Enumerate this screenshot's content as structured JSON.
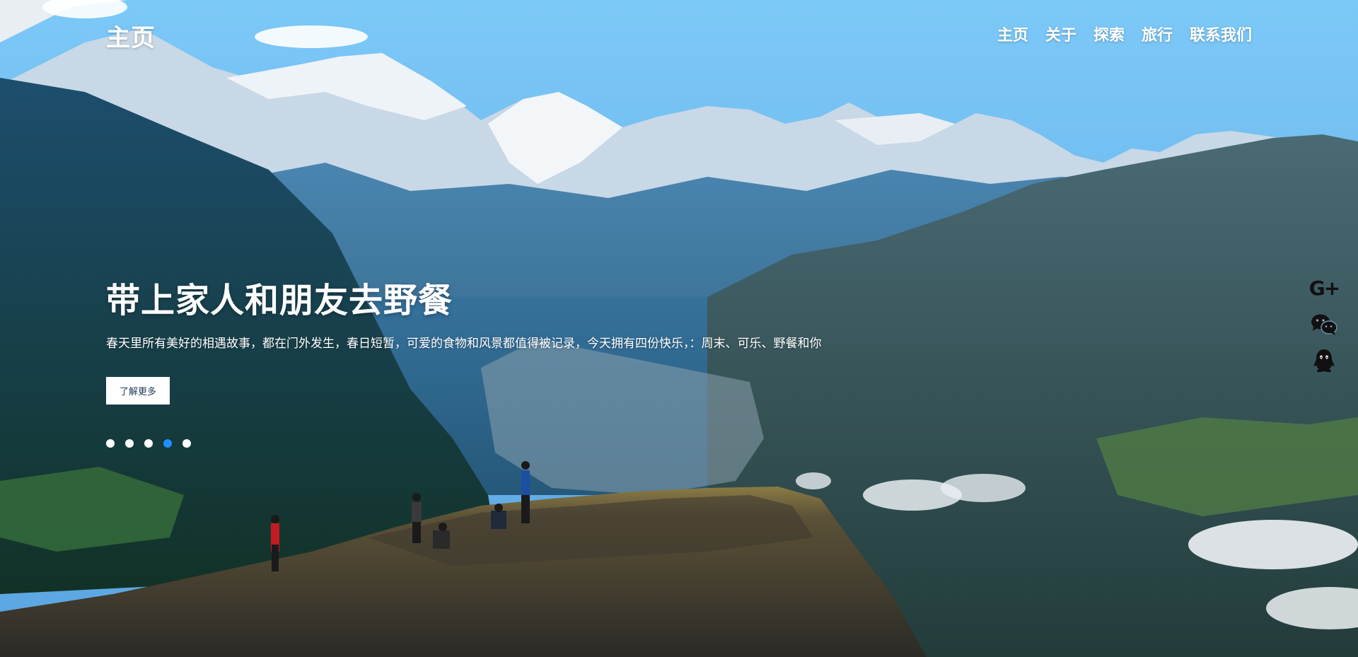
{
  "site": {
    "logo": "主页"
  },
  "nav": {
    "items": [
      "主页",
      "关于",
      "探索",
      "旅行",
      "联系我们"
    ]
  },
  "hero": {
    "title": "带上家人和朋友去野餐",
    "subtitle": "春天里所有美好的相遇故事，都在门外发生，春日短暂，可爱的食物和风景都值得被记录，今天拥有四份快乐，：周末、可乐、野餐和你",
    "button_label": "了解更多"
  },
  "slider": {
    "total": 5,
    "active_index": 3
  },
  "social": {
    "icons": [
      "google-plus-icon",
      "wechat-icon",
      "qq-icon"
    ],
    "gplus_text": "G+"
  },
  "colors": {
    "sky": "#6cb6ee",
    "accent_dot": "#1e90ff",
    "text": "#ffffff",
    "button_text": "#1f3b5b"
  }
}
